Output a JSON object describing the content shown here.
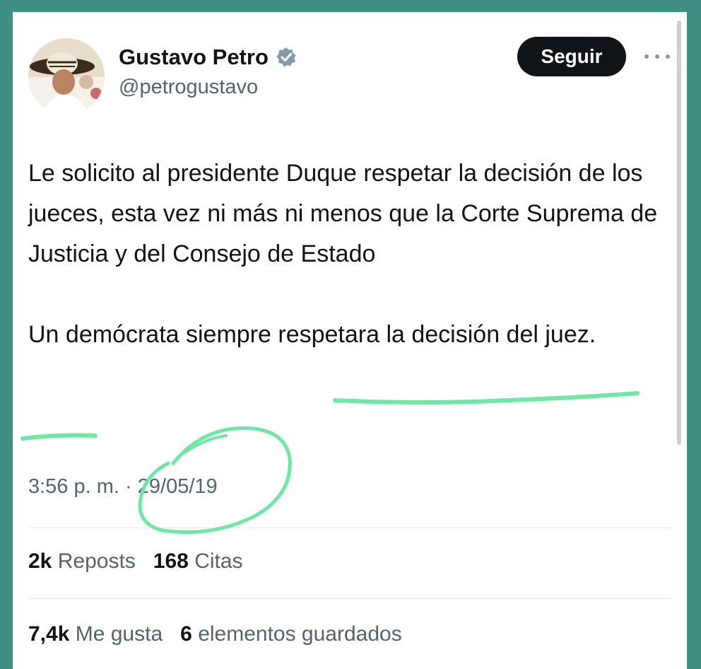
{
  "user": {
    "name": "Gustavo Petro",
    "handle": "@petrogustavo",
    "verified": true
  },
  "follow_label": "Seguir",
  "more_icon": "more-options-icon",
  "tweet": {
    "paragraph1": "Le solicito al presidente Duque respetar la decisión de los jueces, esta vez ni más ni menos que la Corte Suprema de Justicia y del Consejo de Estado",
    "paragraph2_plain": "Un demócrata siempre ",
    "paragraph2_highlight": "respetara la decisión del juez."
  },
  "meta": {
    "time": "3:56 p. m.",
    "separator": "·",
    "date": "29/05/19"
  },
  "stats": {
    "reposts_count": "2k",
    "reposts_label": "Reposts",
    "quotes_count": "168",
    "quotes_label": "Citas",
    "likes_count": "7,4k",
    "likes_label": "Me gusta",
    "bookmarks_count": "6",
    "bookmarks_label": "elementos guardados"
  },
  "colors": {
    "frame": "#3f8f85",
    "annotation": "#6ee8a4",
    "verified": "#829aab"
  }
}
